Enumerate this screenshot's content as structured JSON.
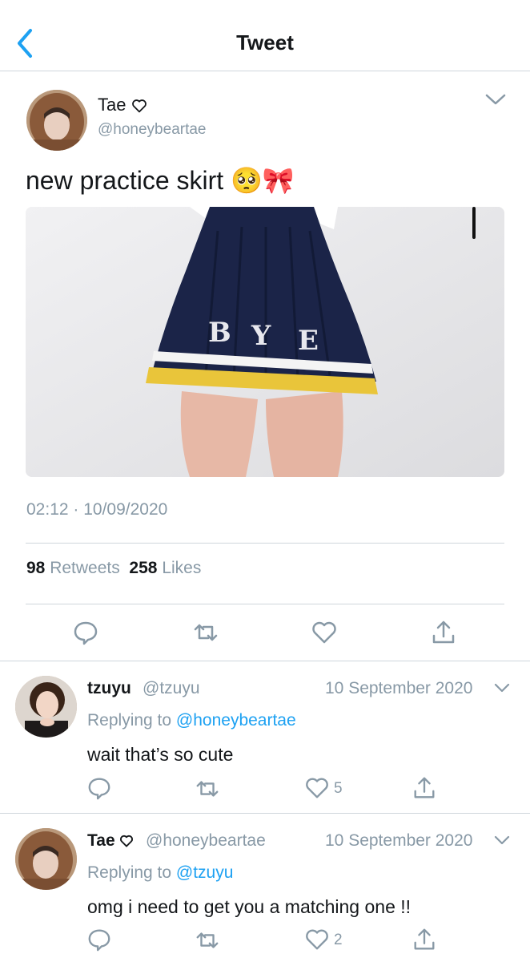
{
  "nav": {
    "title": "Tweet"
  },
  "tweet": {
    "author_name": "Tae",
    "handle": "@honeybeartae",
    "text": "new practice skirt",
    "emoji": "🥺🎀",
    "photo_text": "BYE",
    "timestamp": "02:12 · 10/09/2020",
    "retweets_count": "98",
    "retweets_label": "Retweets",
    "likes_count": "258",
    "likes_label": "Likes"
  },
  "replies": [
    {
      "name": "tzuyu",
      "handle": "@tzuyu",
      "date": "10 September 2020",
      "replying_prefix": "Replying to",
      "replying_to": "@honeybeartae",
      "text": "wait that’s so cute",
      "like_count": "5"
    },
    {
      "name": "Tae",
      "handle": "@honeybeartae",
      "date": "10 September 2020",
      "replying_prefix": "Replying to",
      "replying_to": "@tzuyu",
      "text": "omg i need to get you a matching one !!",
      "like_count": "2"
    }
  ],
  "colors": {
    "accent": "#1da1f2",
    "muted": "#8899a6",
    "text": "#14171a",
    "divider": "#cfd6dc"
  },
  "icons": [
    "back-chevron-icon",
    "heart-outline-icon",
    "chevron-down-icon",
    "reply-icon",
    "retweet-icon",
    "like-icon",
    "share-icon"
  ]
}
